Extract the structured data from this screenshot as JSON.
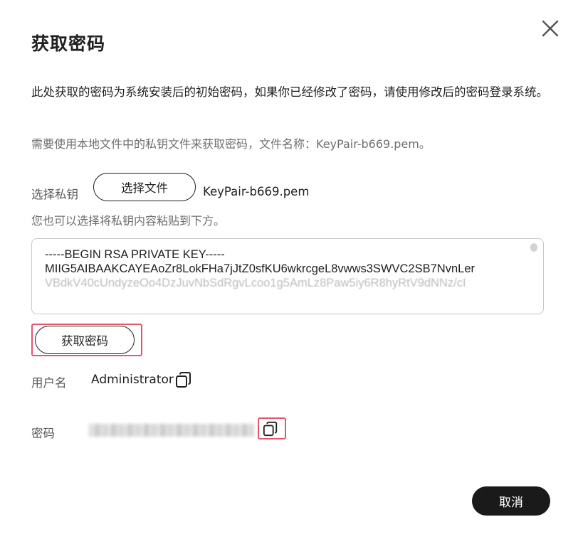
{
  "dialog": {
    "title": "获取密码",
    "description": "此处获取的密码为系统安装后的初始密码，如果你已经修改了密码，请使用修改后的密码登录系统。",
    "hint": "需要使用本地文件中的私钥文件来获取密码，文件名称：KeyPair-b669.pem。",
    "close_icon": "close-icon"
  },
  "key_select": {
    "label": "选择私钥",
    "button_label": "选择文件",
    "file_name": "KeyPair-b669.pem",
    "paste_hint": "您也可以选择将私钥内容粘贴到下方。"
  },
  "key_content": {
    "line1": "-----BEGIN RSA PRIVATE KEY-----",
    "line2": "MIIG5AIBAAKCAYEAoZr8LokFHa7jJtZ0sfKU6wkrcgeL8vwws3SWVC2SB7NvnLer",
    "line3": "VBdkV40cUndyzeOo4DzJuvNbSdRgvLcoo1g5AmLz8Paw5iy6R8hyRtV9dNNz/cI"
  },
  "get_password": {
    "button_label": "获取密码",
    "highlight_color": "#e8546c"
  },
  "result": {
    "username_label": "用户名",
    "username_value": "Administrator",
    "password_label": "密码",
    "copy_icon": "copy-icon"
  },
  "footer": {
    "cancel_label": "取消",
    "cancel_bg": "#1a1a1a"
  }
}
